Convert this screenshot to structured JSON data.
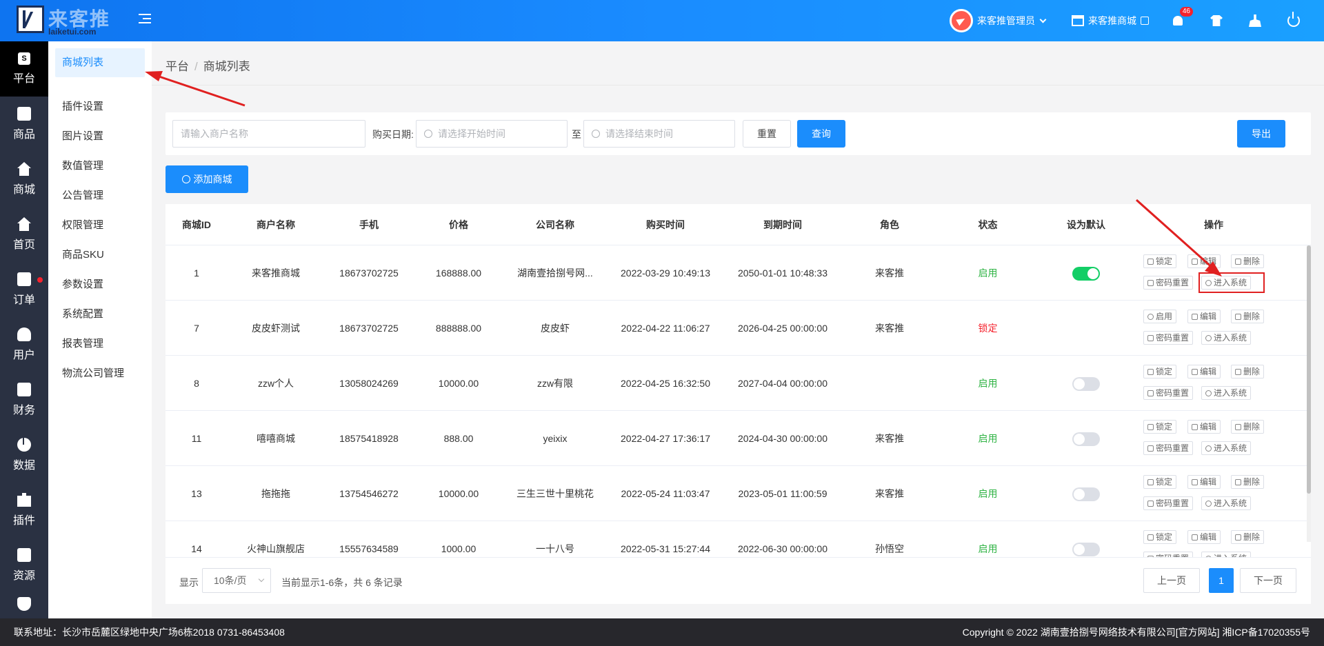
{
  "header": {
    "logo_text_cn": "来客推",
    "logo_text_en": "laiketui.com",
    "admin_name": "来客推管理员",
    "shop_name": "来客推商城",
    "notification_count": "46"
  },
  "iconbar": {
    "items": [
      {
        "label": "平台",
        "icon": "platform-icon"
      },
      {
        "label": "商品",
        "icon": "product-icon"
      },
      {
        "label": "商城",
        "icon": "mall-icon"
      },
      {
        "label": "首页",
        "icon": "home-icon"
      },
      {
        "label": "订单",
        "icon": "order-icon"
      },
      {
        "label": "用户",
        "icon": "user-icon"
      },
      {
        "label": "财务",
        "icon": "wallet-icon"
      },
      {
        "label": "数据",
        "icon": "pie-chart-icon"
      },
      {
        "label": "插件",
        "icon": "puzzle-icon"
      },
      {
        "label": "资源",
        "icon": "image-icon"
      }
    ],
    "platform_icon_glyph": "S"
  },
  "submenu": {
    "items": [
      "商城列表",
      "插件设置",
      "图片设置",
      "数值管理",
      "公告管理",
      "权限管理",
      "商品SKU",
      "参数设置",
      "系统配置",
      "报表管理",
      "物流公司管理"
    ]
  },
  "breadcrumb": {
    "root": "平台",
    "sep": "/",
    "current": "商城列表"
  },
  "filter": {
    "merchant_placeholder": "请输入商户名称",
    "date_label": "购买日期:",
    "start_placeholder": "请选择开始时间",
    "to_label": "至",
    "end_placeholder": "请选择结束时间",
    "reset_label": "重置",
    "query_label": "查询",
    "export_label": "导出"
  },
  "add_button": "添加商城",
  "table": {
    "columns": [
      "商城ID",
      "商户名称",
      "手机",
      "价格",
      "公司名称",
      "购买时间",
      "到期时间",
      "角色",
      "状态",
      "设为默认",
      "操作"
    ],
    "rows": [
      {
        "id": "1",
        "merchant": "来客推商城",
        "phone": "18673702725",
        "price": "168888.00",
        "company": "湖南壹拾捌号网...",
        "buy": "2022-03-29 10:49:13",
        "expire": "2050-01-01 10:48:33",
        "role": "来客推",
        "status": "启用",
        "status_on": true,
        "default": "on",
        "lock_label": "锁定"
      },
      {
        "id": "7",
        "merchant": "皮皮虾测试",
        "phone": "18673702725",
        "price": "888888.00",
        "company": "皮皮虾",
        "buy": "2022-04-22 11:06:27",
        "expire": "2026-04-25 00:00:00",
        "role": "来客推",
        "status": "锁定",
        "status_on": false,
        "default": "none",
        "lock_label": "启用"
      },
      {
        "id": "8",
        "merchant": "zzw个人",
        "phone": "13058024269",
        "price": "10000.00",
        "company": "zzw有限",
        "buy": "2022-04-25 16:32:50",
        "expire": "2027-04-04 00:00:00",
        "role": "",
        "status": "启用",
        "status_on": true,
        "default": "off",
        "lock_label": "锁定"
      },
      {
        "id": "11",
        "merchant": "嘻嘻商城",
        "phone": "18575418928",
        "price": "888.00",
        "company": "yeixix",
        "buy": "2022-04-27 17:36:17",
        "expire": "2024-04-30 00:00:00",
        "role": "来客推",
        "status": "启用",
        "status_on": true,
        "default": "off",
        "lock_label": "锁定"
      },
      {
        "id": "13",
        "merchant": "拖拖拖",
        "phone": "13754546272",
        "price": "10000.00",
        "company": "三生三世十里桃花",
        "buy": "2022-05-24 11:03:47",
        "expire": "2023-05-01 11:00:59",
        "role": "来客推",
        "status": "启用",
        "status_on": true,
        "default": "off",
        "lock_label": "锁定"
      },
      {
        "id": "14",
        "merchant": "火神山旗舰店",
        "phone": "15557634589",
        "price": "1000.00",
        "company": "一十八号",
        "buy": "2022-05-31 15:27:44",
        "expire": "2022-06-30 00:00:00",
        "role": "孙悟空",
        "status": "启用",
        "status_on": true,
        "default": "off",
        "lock_label": "锁定"
      }
    ],
    "ops": {
      "edit": "编辑",
      "delete": "删除",
      "reset_pwd": "密码重置",
      "enter": "进入系统"
    }
  },
  "pagination": {
    "show_label": "显示",
    "page_size": "10条/页",
    "summary": "当前显示1-6条，共 6 条记录",
    "prev": "上一页",
    "current": "1",
    "next": "下一页"
  },
  "footer": {
    "address": "联系地址：长沙市岳麓区绿地中央广场6栋2018 0731-86453408",
    "copyright": "Copyright © 2022 湖南壹拾捌号网络技术有限公司[官方网站]  湘ICP备17020355号"
  },
  "colors": {
    "primary": "#1b8dfc",
    "success": "#2fb344",
    "danger": "#f5222d",
    "annotation": "#e02020"
  }
}
